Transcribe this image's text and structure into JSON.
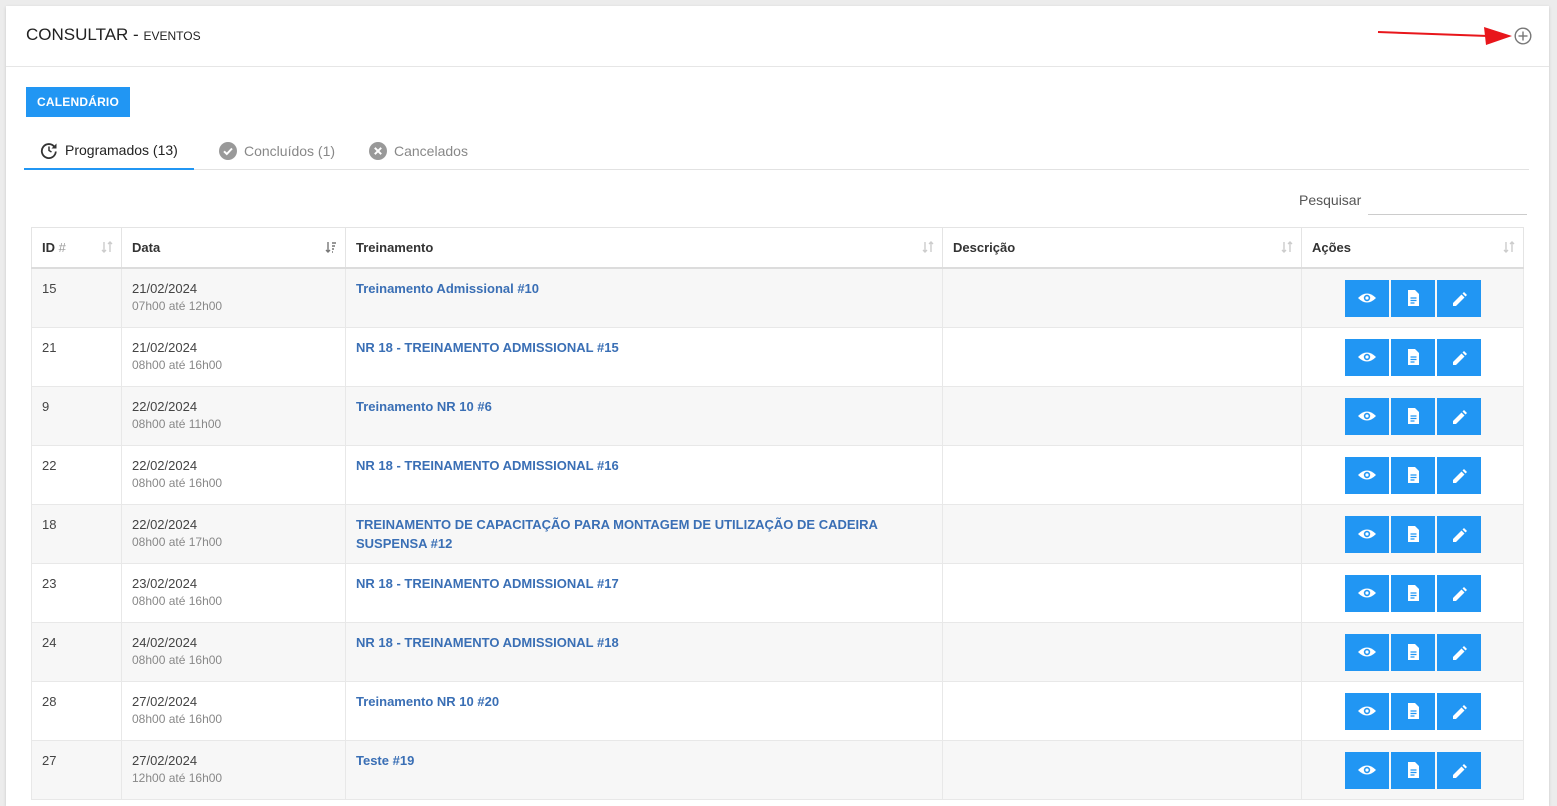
{
  "header": {
    "title": "CONSULTAR - ",
    "subtitle": "EVENTOS"
  },
  "toolbar": {
    "calendar_label": "CALENDÁRIO"
  },
  "tabs": [
    {
      "label": "Programados (13)",
      "icon": "refresh-clock-icon",
      "active": true
    },
    {
      "label": "Concluídos (1)",
      "icon": "check-circle-icon",
      "active": false
    },
    {
      "label": "Cancelados",
      "icon": "x-circle-icon",
      "active": false
    }
  ],
  "search": {
    "label": "Pesquisar",
    "value": "",
    "placeholder": ""
  },
  "table": {
    "headers": {
      "id": "ID",
      "id_suffix": "#",
      "date": "Data",
      "training": "Treinamento",
      "description": "Descrição",
      "actions": "Ações"
    },
    "rows": [
      {
        "id": "15",
        "date": "21/02/2024",
        "time": "07h00 até 12h00",
        "training": "Treinamento Admissional #10",
        "description": ""
      },
      {
        "id": "21",
        "date": "21/02/2024",
        "time": "08h00 até 16h00",
        "training": "NR 18 - TREINAMENTO ADMISSIONAL #15",
        "description": ""
      },
      {
        "id": "9",
        "date": "22/02/2024",
        "time": "08h00 até 11h00",
        "training": "Treinamento NR 10 #6",
        "description": ""
      },
      {
        "id": "22",
        "date": "22/02/2024",
        "time": "08h00 até 16h00",
        "training": "NR 18 - TREINAMENTO ADMISSIONAL #16",
        "description": ""
      },
      {
        "id": "18",
        "date": "22/02/2024",
        "time": "08h00 até 17h00",
        "training": "TREINAMENTO DE CAPACITAÇÃO PARA MONTAGEM DE UTILIZAÇÃO DE CADEIRA SUSPENSA #12",
        "description": ""
      },
      {
        "id": "23",
        "date": "23/02/2024",
        "time": "08h00 até 16h00",
        "training": "NR 18 - TREINAMENTO ADMISSIONAL #17",
        "description": ""
      },
      {
        "id": "24",
        "date": "24/02/2024",
        "time": "08h00 até 16h00",
        "training": "NR 18 - TREINAMENTO ADMISSIONAL #18",
        "description": ""
      },
      {
        "id": "28",
        "date": "27/02/2024",
        "time": "08h00 até 16h00",
        "training": "Treinamento NR 10 #20",
        "description": ""
      },
      {
        "id": "27",
        "date": "27/02/2024",
        "time": "12h00 até 16h00",
        "training": "Teste #19",
        "description": ""
      }
    ],
    "row_actions": [
      "eye-icon",
      "document-icon",
      "pencil-icon"
    ]
  },
  "colors": {
    "accent": "#2196f3",
    "link": "#3a6fb5",
    "arrow": "#e8161b"
  }
}
